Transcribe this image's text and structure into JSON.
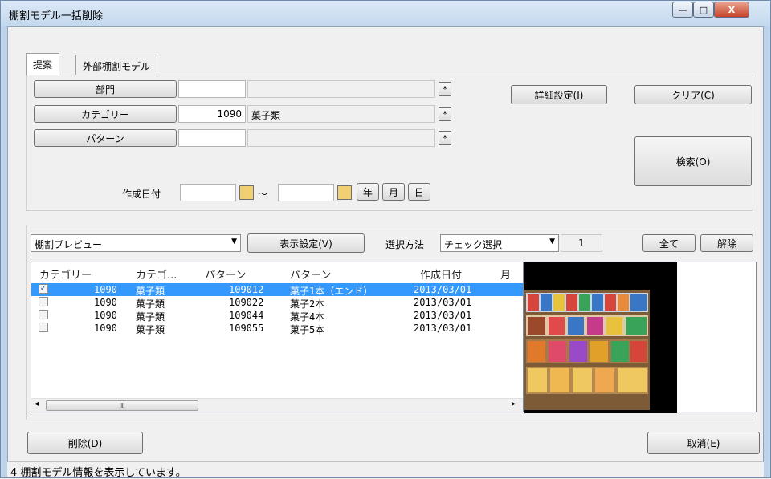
{
  "window": {
    "title": "棚割モデル一括削除",
    "minimize": "—",
    "maximize": "□",
    "close": "X"
  },
  "tabs": [
    {
      "label": "提案"
    },
    {
      "label": "外部棚割モデル"
    }
  ],
  "filters": {
    "department_button": "部門",
    "department_code": "",
    "department_name": "",
    "category_button": "カテゴリー",
    "category_code": "1090",
    "category_name": "菓子類",
    "pattern_button": "パターン",
    "pattern_code": "",
    "pattern_name": "",
    "asterisk": "*",
    "created_date_label": "作成日付",
    "date_from": "",
    "date_to": "",
    "tilde": "～",
    "year_btn": "年",
    "month_btn": "月",
    "day_btn": "日"
  },
  "actions": {
    "detail_settings": "詳細設定(I)",
    "clear": "クリア(C)",
    "search": "検索(O)"
  },
  "results_toolbar": {
    "view_select": "棚割プレビュー",
    "display_settings": "表示設定(V)",
    "selection_method_label": "選択方法",
    "selection_method_value": "チェック選択",
    "count": "1",
    "select_all": "全て",
    "release": "解除"
  },
  "table": {
    "columns": [
      "カテゴリー",
      "カテゴ...",
      "パターン",
      "パターン",
      "作成日付",
      "月"
    ],
    "rows": [
      {
        "checked": "✓",
        "cat_code": "1090",
        "cat_name": "菓子類",
        "pat_code": "109012",
        "pat_name": "菓子1本（エンド）",
        "date": "2013/03/01"
      },
      {
        "checked": "",
        "cat_code": "1090",
        "cat_name": "菓子類",
        "pat_code": "109022",
        "pat_name": "菓子2本",
        "date": "2013/03/01"
      },
      {
        "checked": "",
        "cat_code": "1090",
        "cat_name": "菓子類",
        "pat_code": "109044",
        "pat_name": "菓子4本",
        "date": "2013/03/01"
      },
      {
        "checked": "",
        "cat_code": "1090",
        "cat_name": "菓子類",
        "pat_code": "109055",
        "pat_name": "菓子5本",
        "date": "2013/03/01"
      }
    ],
    "scroll_left": "◂",
    "scroll_right": "▸",
    "thumb_grip": "III"
  },
  "footer": {
    "delete": "削除(D)",
    "cancel": "取消(E)",
    "status": "4 棚割モデル情報を表示しています。"
  },
  "colors": {
    "selected_row": "#3399ff",
    "titlebar": "#c3d8ee",
    "close": "#c7432a"
  }
}
